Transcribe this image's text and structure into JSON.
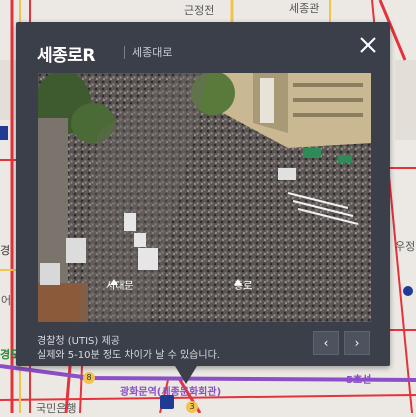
{
  "map": {
    "labels": {
      "geunjeongjeon": "근정전",
      "sejonggwan": "세종관",
      "ujeong": "우정",
      "eo": "어",
      "gyeong": "경",
      "gyeongdo": "경도",
      "gwanghwamun_station": "광화문역(세종문화회관)",
      "line5": "5호선",
      "kookmin_bank": "국민은행"
    },
    "badges": {
      "line5_num": "5",
      "line5_num2": "5",
      "exit8": "8",
      "exit3": "3"
    },
    "colors": {
      "line5": "#8b4fc7",
      "road_red": "#e5333b",
      "badge_blue": "#1f3b94"
    }
  },
  "popup": {
    "title": "세종로R",
    "subtitle": "세종대로",
    "close_icon": "close-icon",
    "camera": {
      "overlay_left": "서대문",
      "overlay_right": "종로"
    },
    "source": "경찰청 (UTIS) 제공",
    "notice": "실제와 5-10분 정도 차이가 날 수 있습니다.",
    "prev_label": "‹",
    "next_label": "›"
  }
}
